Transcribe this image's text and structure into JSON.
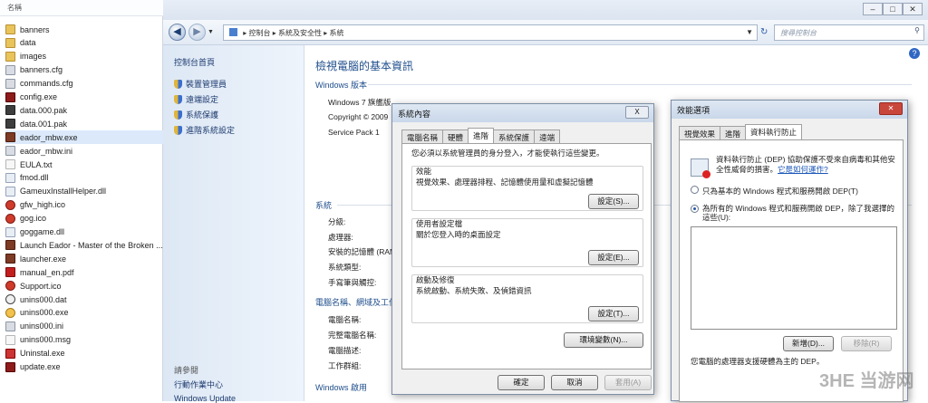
{
  "explorer": {
    "column_header": "名稱",
    "files": [
      {
        "name": "banners",
        "icon": "folder-icon"
      },
      {
        "name": "data",
        "icon": "folder-icon"
      },
      {
        "name": "images",
        "icon": "folder-icon"
      },
      {
        "name": "banners.cfg",
        "icon": "config-file-icon"
      },
      {
        "name": "commands.cfg",
        "icon": "config-file-icon"
      },
      {
        "name": "config.exe",
        "icon": "exe-icon"
      },
      {
        "name": "data.000.pak",
        "icon": "pak-file-icon"
      },
      {
        "name": "data.001.pak",
        "icon": "pak-file-icon"
      },
      {
        "name": "eador_mbw.exe",
        "icon": "game-exe-icon"
      },
      {
        "name": "eador_mbw.ini",
        "icon": "ini-file-icon"
      },
      {
        "name": "EULA.txt",
        "icon": "text-file-icon"
      },
      {
        "name": "fmod.dll",
        "icon": "dll-file-icon"
      },
      {
        "name": "GameuxInstallHelper.dll",
        "icon": "dll-file-icon"
      },
      {
        "name": "gfw_high.ico",
        "icon": "ico-file-icon"
      },
      {
        "name": "gog.ico",
        "icon": "ico-file-icon"
      },
      {
        "name": "goggame.dll",
        "icon": "dll-file-icon"
      },
      {
        "name": "Launch Eador - Master of the Broken ...",
        "icon": "shortcut-icon"
      },
      {
        "name": "launcher.exe",
        "icon": "game-exe-icon"
      },
      {
        "name": "manual_en.pdf",
        "icon": "pdf-file-icon"
      },
      {
        "name": "Support.ico",
        "icon": "ico-file-icon"
      },
      {
        "name": "unins000.dat",
        "icon": "dat-file-icon"
      },
      {
        "name": "unins000.exe",
        "icon": "uninstaller-icon"
      },
      {
        "name": "unins000.ini",
        "icon": "ini-file-icon"
      },
      {
        "name": "unins000.msg",
        "icon": "text-file-icon"
      },
      {
        "name": "Uninstal.exe",
        "icon": "uninstall-cross-icon"
      },
      {
        "name": "update.exe",
        "icon": "exe-icon"
      }
    ]
  },
  "control_panel": {
    "breadcrumb": [
      "控制台",
      "系統及安全性",
      "系統"
    ],
    "search_placeholder": "搜尋控制台",
    "sidebar": {
      "home": "控制台首頁",
      "links": [
        "裝置管理員",
        "遠端設定",
        "系統保護",
        "進階系統設定"
      ],
      "see_also": "請參閱",
      "see_also_links": [
        "行動作業中心",
        "Windows Update"
      ]
    },
    "main": {
      "title": "檢視電腦的基本資訊",
      "windows_edition_heading": "Windows 版本",
      "edition": "Windows 7 旗艦版",
      "copyright": "Copyright © 2009",
      "service_pack": "Service Pack 1",
      "system_heading": "系統",
      "system_labels": [
        "分級:",
        "處理器:",
        "安裝的記憶體 (RAM",
        "系統類型:",
        "手寫筆與觸控:"
      ],
      "computer_heading": "電腦名稱、網域及工作群",
      "computer_labels": [
        "電腦名稱:",
        "完整電腦名稱:",
        "電腦描述:",
        "工作群組:"
      ],
      "activation_heading": "Windows 啟用"
    }
  },
  "system_properties": {
    "title": "系統內容",
    "close_label": "X",
    "tabs": [
      "電腦名稱",
      "硬體",
      "進階",
      "系統保護",
      "遠端"
    ],
    "active_tab": 2,
    "admin_note": "您必須以系統管理員的身分登入，才能使執行這些變更。",
    "performance": {
      "title": "效能",
      "desc": "視覺效果、處理器排程、記憶體使用量和虛擬記憶體",
      "button": "設定(S)..."
    },
    "user_profiles": {
      "title": "使用者設定檔",
      "desc": "關於您登入時的桌面設定",
      "button": "設定(E)..."
    },
    "startup_recovery": {
      "title": "啟動及修復",
      "desc": "系統啟動、系統失敗、及偵錯資訊",
      "button": "設定(T)..."
    },
    "env_button": "環境變數(N)...",
    "ok": "確定",
    "cancel": "取消",
    "apply": "套用(A)"
  },
  "performance_options": {
    "title": "效能選項",
    "tabs": [
      "視覺效果",
      "進階",
      "資料執行防止"
    ],
    "active_tab": 2,
    "dep_desc": "資料執行防止 (DEP) 協助保護不受來自病毒和其他安全性威脅的損害。",
    "dep_link": "它是如何運作?",
    "option1": "只為基本的 Windows 程式和服務開啟 DEP(T)",
    "option2": "為所有的 Windows 程式和服務開啟 DEP，除了我選擇的這些(U):",
    "selected_option": 2,
    "add_button": "新增(D)...",
    "remove_button": "移除(R)",
    "footer": "您電腦的處理器支援硬體為主的 DEP。"
  },
  "watermark": "3HE 当游网"
}
